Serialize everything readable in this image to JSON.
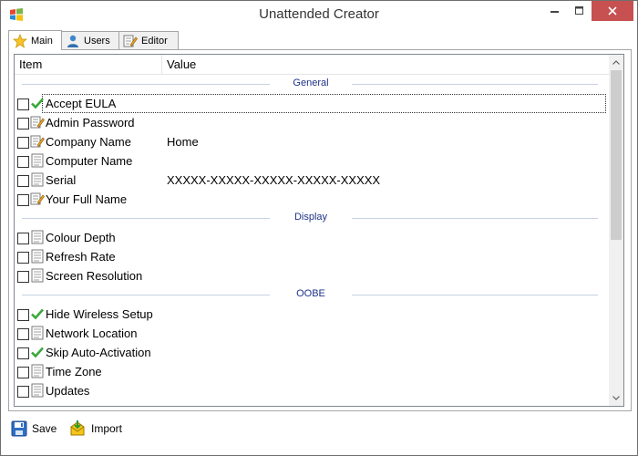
{
  "window": {
    "title": "Unattended Creator"
  },
  "tabs": [
    {
      "label": "Main",
      "icon": "star-icon",
      "active": true
    },
    {
      "label": "Users",
      "icon": "user-icon",
      "active": false
    },
    {
      "label": "Editor",
      "icon": "edit-icon",
      "active": false
    }
  ],
  "list": {
    "columns": [
      "Item",
      "Value"
    ],
    "groups": [
      {
        "name": "General",
        "items": [
          {
            "name": "Accept EULA",
            "value": "",
            "icon": "check-icon",
            "checked": false
          },
          {
            "name": "Admin Password",
            "value": "",
            "icon": "pencil-icon",
            "checked": false
          },
          {
            "name": "Company Name",
            "value": "Home",
            "icon": "pencil-icon",
            "checked": false
          },
          {
            "name": "Computer Name",
            "value": "",
            "icon": "list-icon",
            "checked": false
          },
          {
            "name": "Serial",
            "value": "XXXXX-XXXXX-XXXXX-XXXXX-XXXXX",
            "icon": "list-icon",
            "checked": false
          },
          {
            "name": "Your Full Name",
            "value": "",
            "icon": "pencil-icon",
            "checked": false
          }
        ]
      },
      {
        "name": "Display",
        "items": [
          {
            "name": "Colour Depth",
            "value": "",
            "icon": "list-icon",
            "checked": false
          },
          {
            "name": "Refresh Rate",
            "value": "",
            "icon": "list-icon",
            "checked": false
          },
          {
            "name": "Screen Resolution",
            "value": "",
            "icon": "list-icon",
            "checked": false
          }
        ]
      },
      {
        "name": "OOBE",
        "items": [
          {
            "name": "Hide Wireless Setup",
            "value": "",
            "icon": "check-icon",
            "checked": false
          },
          {
            "name": "Network Location",
            "value": "",
            "icon": "list-icon",
            "checked": false
          },
          {
            "name": "Skip Auto-Activation",
            "value": "",
            "icon": "check-icon",
            "checked": false
          },
          {
            "name": "Time Zone",
            "value": "",
            "icon": "list-icon",
            "checked": false
          },
          {
            "name": "Updates",
            "value": "",
            "icon": "list-icon",
            "checked": false
          }
        ]
      }
    ]
  },
  "toolbar": {
    "save_label": "Save",
    "import_label": "Import"
  },
  "colors": {
    "group_header": "#1e3287",
    "close_button": "#c75050",
    "check_green": "#3aa83a"
  }
}
